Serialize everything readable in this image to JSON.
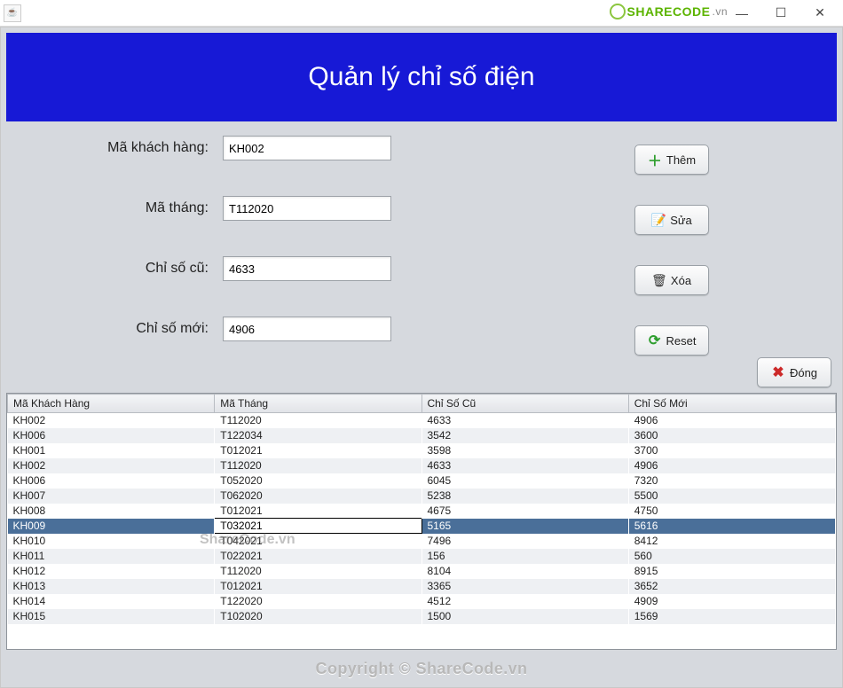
{
  "titlebar": {
    "java_icon": "☕",
    "sharecode_brand": "SHARECODE",
    "sharecode_suffix": ".vn"
  },
  "win": {
    "minimize": "—",
    "maximize": "☐",
    "close": "✕"
  },
  "header": {
    "title": "Quản lý chỉ số điện"
  },
  "form": {
    "customer_label": "Mã khách hàng:",
    "customer_value": "KH002",
    "month_label": "Mã tháng:",
    "month_value": "T112020",
    "old_label": "Chỉ số cũ:",
    "old_value": "4633",
    "new_label": "Chỉ số mới:",
    "new_value": "4906"
  },
  "buttons": {
    "add": "Thêm",
    "edit": "Sửa",
    "delete": "Xóa",
    "reset": "Reset",
    "close": "Đóng"
  },
  "table": {
    "headers": {
      "c0": "Mã Khách Hàng",
      "c1": "Mã Tháng",
      "c2": "Chỉ Số Cũ",
      "c3": "Chỉ Số Mới"
    },
    "rows": [
      {
        "c0": "KH002",
        "c1": "T112020",
        "c2": "4633",
        "c3": "4906"
      },
      {
        "c0": "KH006",
        "c1": "T122034",
        "c2": "3542",
        "c3": "3600"
      },
      {
        "c0": "KH001",
        "c1": "T012021",
        "c2": "3598",
        "c3": "3700"
      },
      {
        "c0": "KH002",
        "c1": "T112020",
        "c2": "4633",
        "c3": "4906"
      },
      {
        "c0": "KH006",
        "c1": "T052020",
        "c2": "6045",
        "c3": "7320"
      },
      {
        "c0": "KH007",
        "c1": "T062020",
        "c2": "5238",
        "c3": "5500"
      },
      {
        "c0": "KH008",
        "c1": "T012021",
        "c2": "4675",
        "c3": "4750"
      },
      {
        "c0": "KH009",
        "c1": "T032021",
        "c2": "5165",
        "c3": "5616",
        "selected": true,
        "editing_col": "c1"
      },
      {
        "c0": "KH010",
        "c1": "T042021",
        "c2": "7496",
        "c3": "8412"
      },
      {
        "c0": "KH011",
        "c1": "T022021",
        "c2": "156",
        "c3": "560"
      },
      {
        "c0": "KH012",
        "c1": "T112020",
        "c2": "8104",
        "c3": "8915"
      },
      {
        "c0": "KH013",
        "c1": "T012021",
        "c2": "3365",
        "c3": "3652"
      },
      {
        "c0": "KH014",
        "c1": "T122020",
        "c2": "4512",
        "c3": "4909"
      },
      {
        "c0": "KH015",
        "c1": "T102020",
        "c2": "1500",
        "c3": "1569"
      }
    ]
  },
  "watermark": {
    "table": "ShareCode.vn",
    "footer": "Copyright © ShareCode.vn"
  }
}
